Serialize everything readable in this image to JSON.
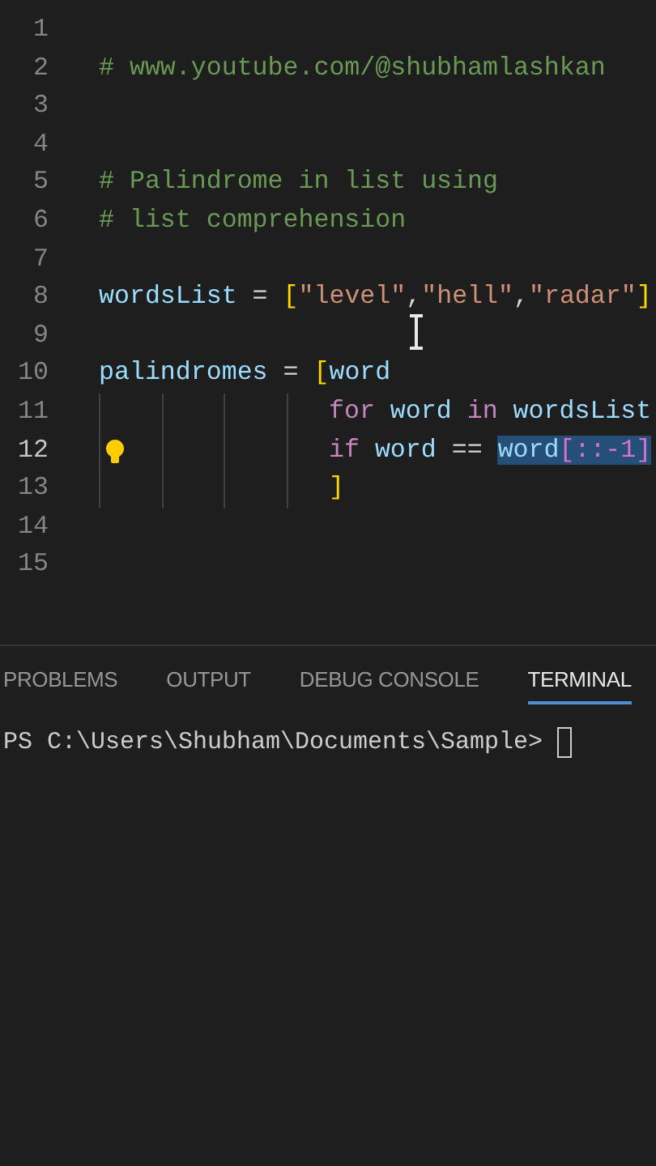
{
  "editor": {
    "lines": [
      {
        "number": "1",
        "current": false
      },
      {
        "number": "2",
        "current": false,
        "tokens": [
          {
            "text": "# www.youtube.com/@shubhamlashkan",
            "kind": "comment",
            "selected": false
          }
        ]
      },
      {
        "number": "3",
        "current": false
      },
      {
        "number": "4",
        "current": false
      },
      {
        "number": "5",
        "current": false,
        "tokens": [
          {
            "text": "# Palindrome in list using",
            "kind": "comment",
            "selected": false
          }
        ]
      },
      {
        "number": "6",
        "current": false,
        "tokens": [
          {
            "text": "# list comprehension",
            "kind": "comment",
            "selected": false
          }
        ]
      },
      {
        "number": "7",
        "current": false
      },
      {
        "number": "8",
        "current": false,
        "tokens": [
          {
            "text": "wordsList",
            "kind": "variable",
            "selected": false
          },
          {
            "text": " = ",
            "kind": "operator",
            "selected": false
          },
          {
            "text": "[",
            "kind": "bracket",
            "selected": false
          },
          {
            "text": "\"level\"",
            "kind": "string",
            "selected": false
          },
          {
            "text": ",",
            "kind": "operator",
            "selected": false
          },
          {
            "text": "\"hell\"",
            "kind": "string",
            "selected": false
          },
          {
            "text": ",",
            "kind": "operator",
            "selected": false
          },
          {
            "text": "\"radar\"",
            "kind": "string",
            "selected": false
          },
          {
            "text": "]",
            "kind": "bracket",
            "selected": false
          }
        ]
      },
      {
        "number": "9",
        "current": false
      },
      {
        "number": "10",
        "current": false,
        "tokens": [
          {
            "text": "palindromes",
            "kind": "variable",
            "selected": false
          },
          {
            "text": " = ",
            "kind": "operator",
            "selected": false
          },
          {
            "text": "[",
            "kind": "bracket",
            "selected": false
          },
          {
            "text": "word",
            "kind": "variable",
            "selected": false
          }
        ]
      },
      {
        "number": "11",
        "current": false,
        "indented": true,
        "tokens": [
          {
            "text": "for",
            "kind": "keyword",
            "selected": false
          },
          {
            "text": " word ",
            "kind": "variable",
            "selected": false
          },
          {
            "text": "in",
            "kind": "keyword",
            "selected": false
          },
          {
            "text": " wordsList",
            "kind": "variable",
            "selected": false
          }
        ]
      },
      {
        "number": "12",
        "current": true,
        "indented": true,
        "tokens": [
          {
            "text": "if",
            "kind": "keyword",
            "selected": false
          },
          {
            "text": " word ",
            "kind": "variable",
            "selected": false
          },
          {
            "text": "== ",
            "kind": "operator",
            "selected": false
          },
          {
            "text": "word",
            "kind": "variable",
            "selected": true
          },
          {
            "text": "[::-1]",
            "kind": "bracket2",
            "selected": true
          }
        ]
      },
      {
        "number": "13",
        "current": false,
        "indented": true,
        "tokens": [
          {
            "text": "]",
            "kind": "bracket",
            "selected": false
          }
        ]
      },
      {
        "number": "14",
        "current": false
      },
      {
        "number": "15",
        "current": false
      }
    ]
  },
  "panel": {
    "tabs": [
      {
        "label": "PROBLEMS",
        "selected": false
      },
      {
        "label": "OUTPUT",
        "selected": false
      },
      {
        "label": "DEBUG CONSOLE",
        "selected": false
      },
      {
        "label": "TERMINAL",
        "selected": true
      }
    ],
    "terminal": {
      "prompt": "PS C:\\Users\\Shubham\\Documents\\Sample> "
    }
  }
}
